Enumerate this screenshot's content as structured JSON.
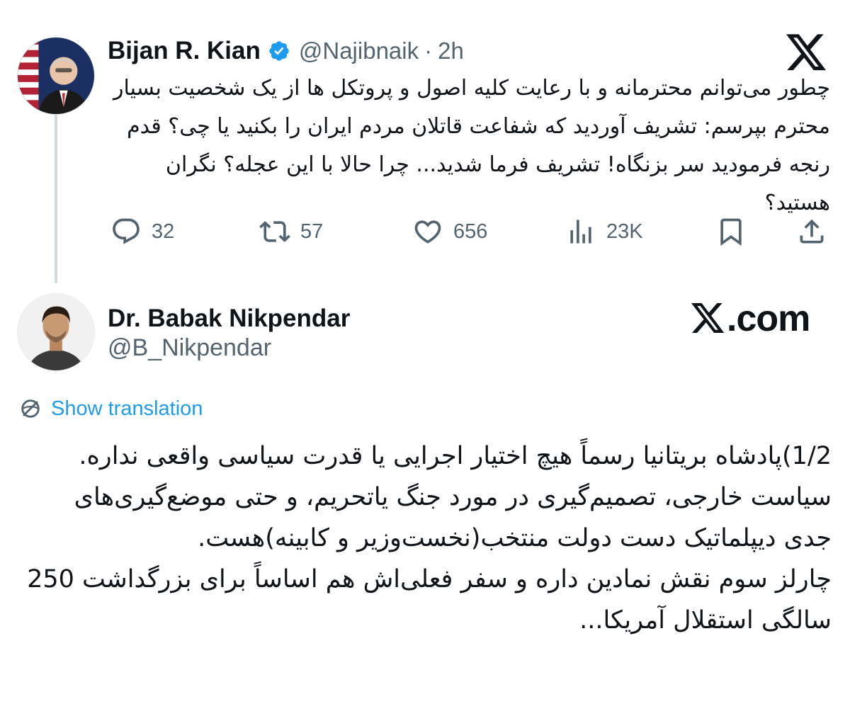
{
  "tweet1": {
    "author": {
      "name": "Bijan R. Kian",
      "handle": "@Najibnaik",
      "separator": "·",
      "time": "2h",
      "verified": true
    },
    "text": "چطور می‌توانم محترمانه و با رعایت کلیه اصول و پروتکل ها از یک شخصیت بسیار محترم بپرسم: تشریف آوردید که شفاعت قاتلان مردم ایران را بکنید یا چی؟ قدم رنجه فرمودید سر بزنگاه! تشریف فرما شدید... چرا حالا با این عجله؟ نگران هستید؟",
    "actions": {
      "replies": "32",
      "reposts": "57",
      "likes": "656",
      "views": "23K"
    }
  },
  "tweet2": {
    "author": {
      "name": "Dr. Babak Nikpendar",
      "handle": "@B_Nikpendar"
    },
    "show_translation": "Show translation",
    "paragraphs": [
      "1/2)پادشاه بریتانیا رسماً هیچ اختیار اجرایی یا قدرت سیاسی واقعی نداره. سیاست خارجی، تصمیم‌گیری در مورد جنگ یاتحریم، و حتی موضع‌گیری‌های جدی دیپلماتیک دست دولت منتخب(نخست‌وزیر و کابینه)هست.",
      "چارلز سوم نقش نمادین داره و سفر فعلی‌اش هم اساساً برای بزرگداشت 250 سالگی استقلال آمریکا..."
    ]
  },
  "watermark": {
    "x_letter": "X",
    "suffix": ".com"
  },
  "icons": {
    "verified": "verified-badge-icon",
    "x_logo": "x-logo-icon",
    "reply": "reply-icon",
    "repost": "repost-icon",
    "like": "heart-icon",
    "views": "views-icon",
    "bookmark": "bookmark-icon",
    "share": "share-icon",
    "translate": "translate-icon"
  },
  "colors": {
    "text": "#0f1419",
    "secondary": "#536471",
    "link": "#1d9bf0",
    "thread_line": "#cfd9de",
    "verified": "#1d9bf0"
  }
}
